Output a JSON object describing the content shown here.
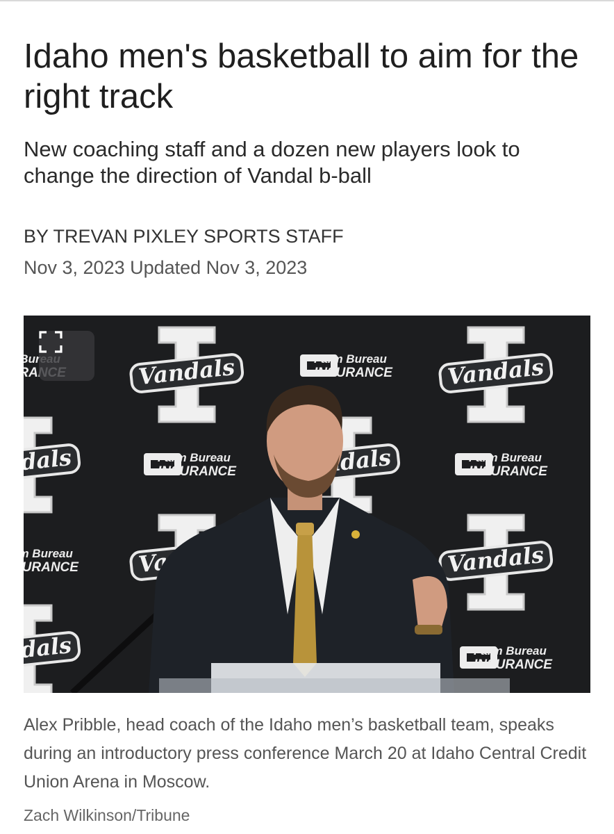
{
  "article": {
    "headline": "Idaho men's basketball to aim for the right track",
    "subheadline": "New coaching staff and a dozen new players look to change the direction of Vandal b-ball",
    "byline": "BY TREVAN PIXLEY SPORTS STAFF",
    "dateline": "Nov 3, 2023 Updated Nov 3, 2023"
  },
  "photo": {
    "expand_icon": "expand-icon",
    "backdrop_vandals": "Vandals",
    "backdrop_farm": "Farm Bureau",
    "backdrop_insurance": "INSURANCE",
    "caption": "Alex Pribble, head coach of the Idaho men’s basketball team, speaks during an introductory press conference March 20 at Idaho Central Credit Union Arena in Moscow.",
    "credit": "Zach Wilkinson/Tribune"
  },
  "colors": {
    "backdrop": "#1c1d1f",
    "logo_white": "#f2f2f2",
    "tie_gold": "#b8933a",
    "suit": "#1e2228"
  }
}
